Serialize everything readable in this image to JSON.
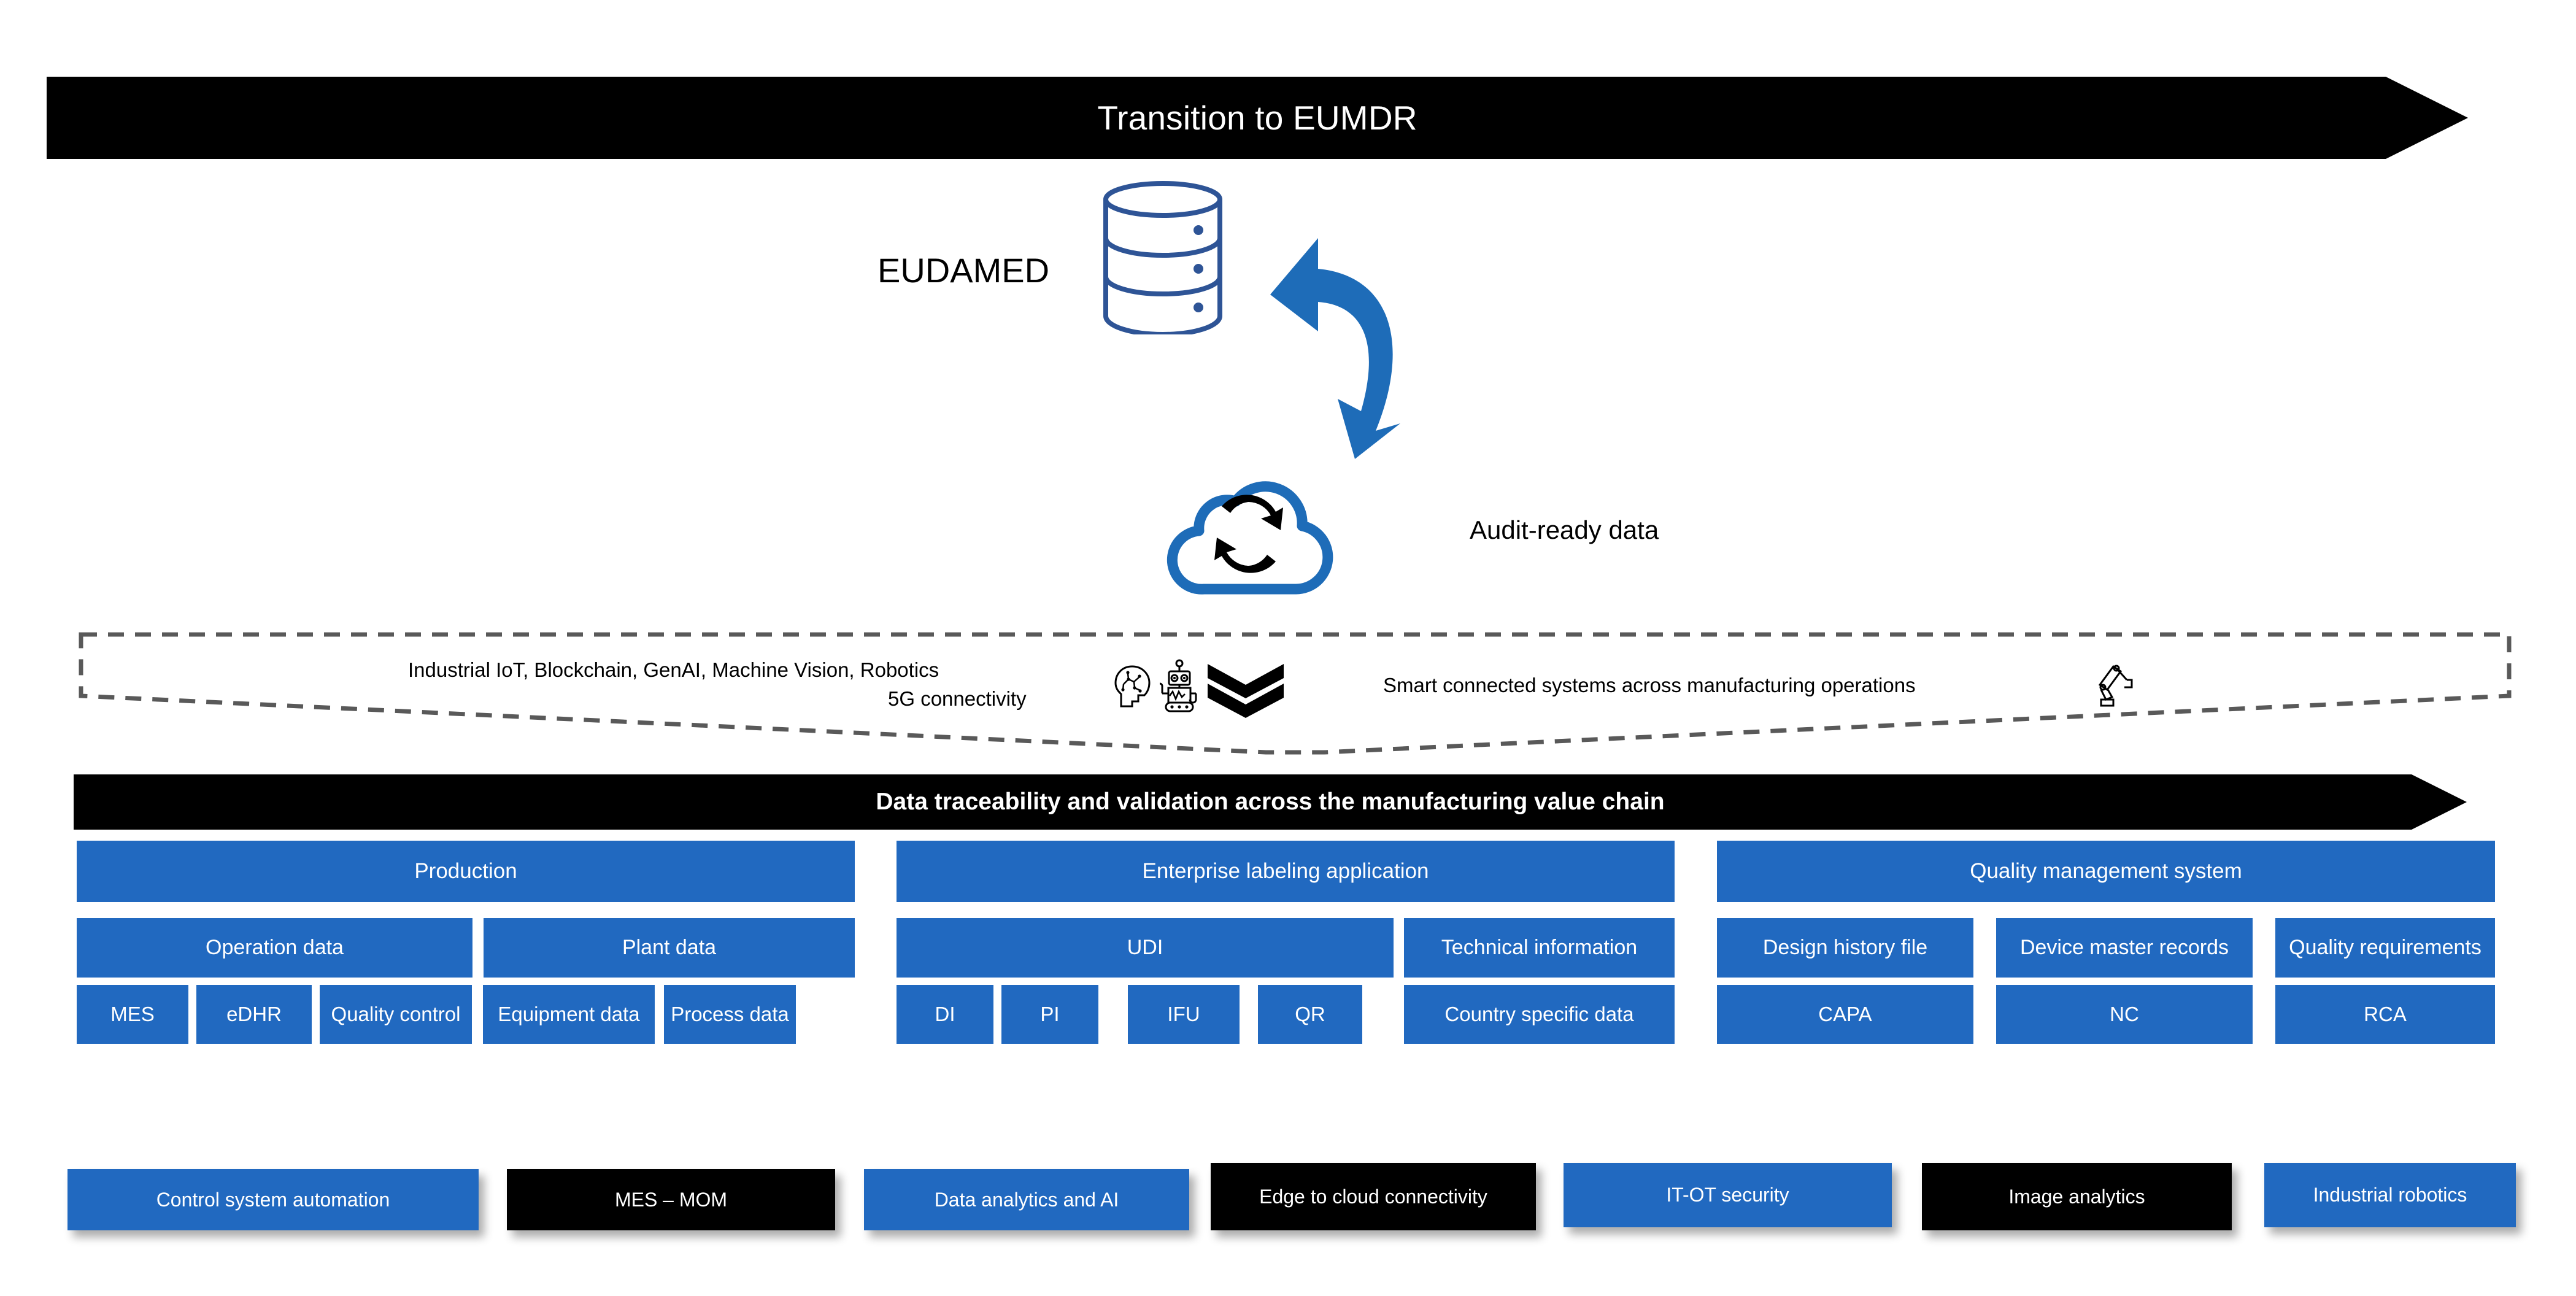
{
  "title_banner": {
    "text": "Transition to EUMDR"
  },
  "top_diagram": {
    "eudamed_label": "EUDAMED",
    "audit_label": "Audit-ready data",
    "database_icon": "database-cylinder-icon",
    "arrow_icon": "curved-up-arrow-icon",
    "cloud_icon": "cloud-sync-icon"
  },
  "tech_band": {
    "line1": "Industrial IoT, Blockchain, GenAI, Machine Vision, Robotics",
    "line2": "5G connectivity",
    "line3": "Smart connected systems across manufacturing operations",
    "icons": [
      "ai-brain-head-icon",
      "robot-icon",
      "double-chevron-down-icon",
      "robot-arm-icon"
    ]
  },
  "traceability_banner": {
    "text": "Data traceability and validation across the manufacturing value chain"
  },
  "columns": [
    {
      "header": "Production",
      "mid": [
        "Operation data",
        "Plant data"
      ],
      "leaves": [
        "MES",
        "eDHR",
        "Quality control",
        "Equipment data",
        "Process data"
      ]
    },
    {
      "header": "Enterprise labeling application",
      "mid": [
        "UDI",
        "Technical information"
      ],
      "leaves": [
        "DI",
        "PI",
        "IFU",
        "QR",
        "Country specific data"
      ]
    },
    {
      "header": "Quality management system",
      "mid": [
        "Design history file",
        "Device master records",
        "Quality requirements"
      ],
      "leaves": [
        "CAPA",
        "NC",
        "RCA"
      ]
    }
  ],
  "bottom_row": [
    {
      "label": "Control system automation",
      "style": "blue"
    },
    {
      "label": "MES – MOM",
      "style": "black"
    },
    {
      "label": "Data analytics and AI",
      "style": "blue"
    },
    {
      "label": "Edge to cloud connectivity",
      "style": "black"
    },
    {
      "label": "IT-OT security",
      "style": "blue"
    },
    {
      "label": "Image analytics",
      "style": "black"
    },
    {
      "label": "Industrial robotics",
      "style": "blue"
    }
  ],
  "colors": {
    "accent_blue": "#2169C0",
    "dark_blue": "#2E5496",
    "black": "#000000",
    "white": "#FFFFFF"
  }
}
